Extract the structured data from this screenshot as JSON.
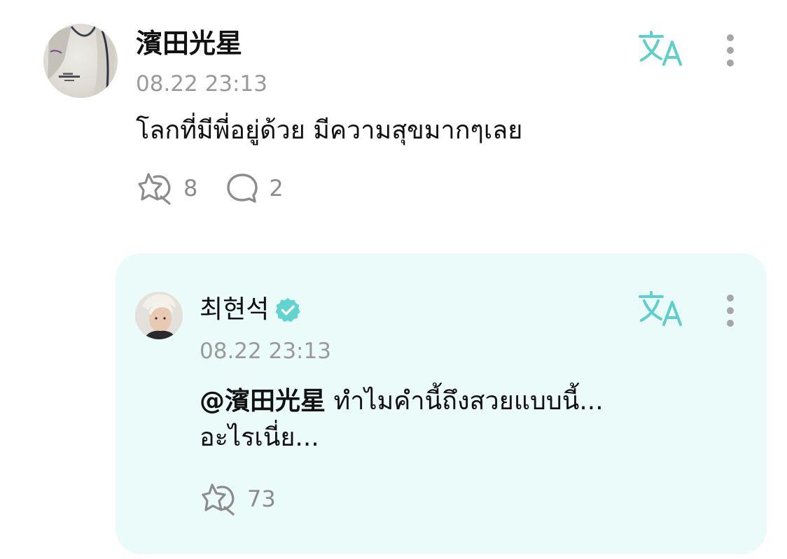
{
  "comment": {
    "username": "濱田光星",
    "timestamp": "08.22 23:13",
    "body": "โลกที่มีพี่อยู่ด้วย มีความสุขมากๆเลย",
    "reactions_count": "8",
    "replies_count": "2",
    "icons": {
      "translate": "translate-icon",
      "more": "more-vertical-icon",
      "reaction": "sparkle-reaction-icon",
      "reply": "speech-bubble-icon"
    }
  },
  "reply": {
    "username": "최현석",
    "verified": true,
    "timestamp": "08.22 23:13",
    "mention": "@濱田光星",
    "body_line1": "ทำไมคำนี้ถึงสวยแบบนี้...",
    "body_line2": "อะไรเนี่ย...",
    "reactions_count": "73",
    "icons": {
      "translate": "translate-icon",
      "more": "more-vertical-icon",
      "reaction": "sparkle-reaction-icon",
      "verified": "verified-badge-icon"
    }
  },
  "colors": {
    "accent": "#5ecfc9",
    "verified": "#62d3cf",
    "reply_background": "#eafbf9",
    "muted_text": "#9a9a9a",
    "icon_gray": "#8c8c8c",
    "text": "#111111"
  }
}
